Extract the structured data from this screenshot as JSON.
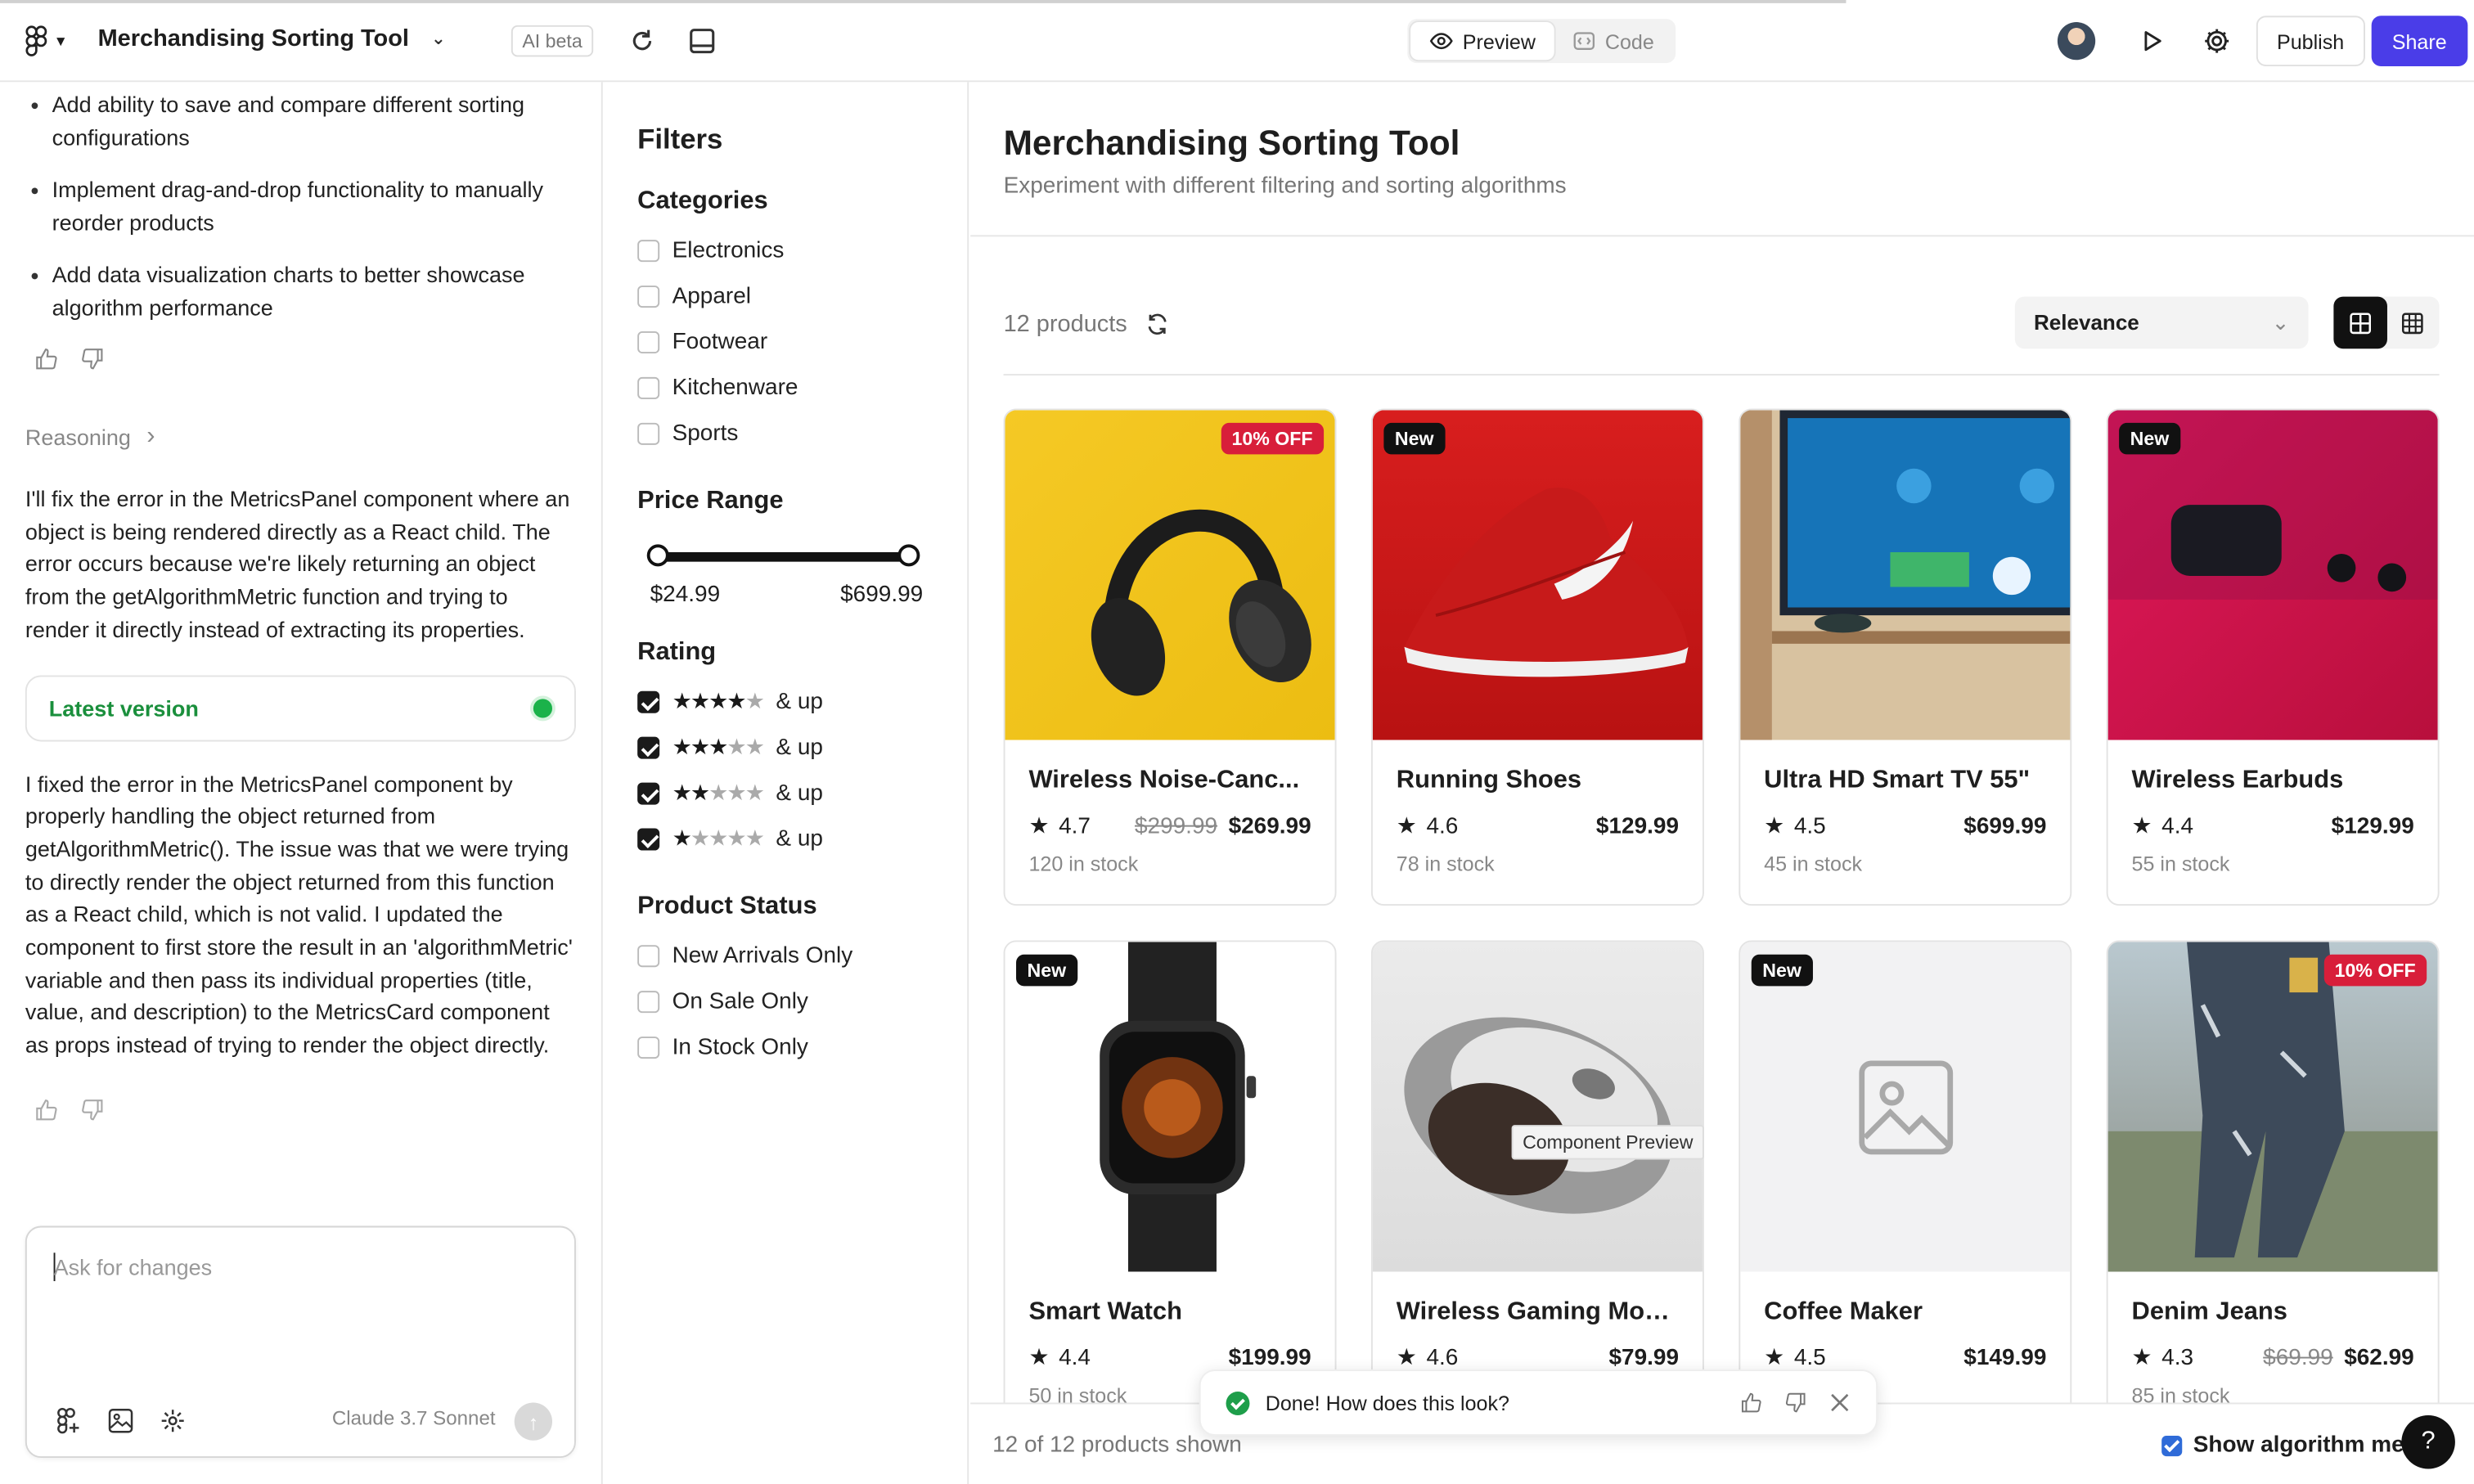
{
  "app": {
    "title": "Merchandising Sorting Tool",
    "ai_badge": "AI beta",
    "tabs": [
      "Preview",
      "Code"
    ],
    "active_tab": "Preview",
    "publish_label": "Publish",
    "share_label": "Share",
    "accent_color": "#4a3de8"
  },
  "chat": {
    "bullets": [
      "Add ability to save and compare different sorting configurations",
      "Implement drag-and-drop functionality to manually reorder products",
      "Add data visualization charts to better showcase algorithm performance"
    ],
    "reasoning_label": "Reasoning",
    "paragraph1": "I'll fix the error in the MetricsPanel component where an object is being rendered directly as a React child. The error occurs because we're likely returning an object from the getAlgorithmMetric function and trying to render it directly instead of extracting its properties.",
    "latest_version_label": "Latest version",
    "paragraph2": "I fixed the error in the MetricsPanel component by properly handling the object returned from getAlgorithmMetric(). The issue was that we were trying to directly render the object returned from this function as a React child, which is not valid. I updated the component to first store the result in an 'algorithmMetric' variable and then pass its individual properties (title, value, and description) to the MetricsCard component as props instead of trying to render the object directly.",
    "input_placeholder": "Ask for changes",
    "model_name": "Claude 3.7 Sonnet"
  },
  "filters": {
    "heading": "Filters",
    "categories_heading": "Categories",
    "categories": [
      "Electronics",
      "Apparel",
      "Footwear",
      "Kitchenware",
      "Sports"
    ],
    "price_heading": "Price Range",
    "price_min": "$24.99",
    "price_max": "$699.99",
    "rating_heading": "Rating",
    "rating_suffix": "& up",
    "ratings": [
      4,
      3,
      2,
      1
    ],
    "status_heading": "Product Status",
    "statuses": [
      "New Arrivals Only",
      "On Sale Only",
      "In Stock Only"
    ]
  },
  "main": {
    "title": "Merchandising Sorting Tool",
    "subtitle": "Experiment with different filtering and sorting algorithms",
    "count": "12 products",
    "sort_value": "Relevance",
    "footer_shown": "12 of 12 products shown",
    "footer_toggle": "Show algorithm me",
    "tooltip": "Component Preview"
  },
  "products": [
    {
      "name": "Wireless Noise-Canc...",
      "rating": "4.7",
      "orig": "$299.99",
      "price": "$269.99",
      "stock": "120 in stock",
      "badge": "10% OFF",
      "image": "headphones"
    },
    {
      "name": "Running Shoes",
      "rating": "4.6",
      "orig": "",
      "price": "$129.99",
      "stock": "78 in stock",
      "badge": "New",
      "image": "shoe"
    },
    {
      "name": "Ultra HD Smart TV 55\"",
      "rating": "4.5",
      "orig": "",
      "price": "$699.99",
      "stock": "45 in stock",
      "badge": "",
      "image": "tv"
    },
    {
      "name": "Wireless Earbuds",
      "rating": "4.4",
      "orig": "",
      "price": "$129.99",
      "stock": "55 in stock",
      "badge": "New",
      "image": "earbuds"
    },
    {
      "name": "Smart Watch",
      "rating": "4.4",
      "orig": "",
      "price": "$199.99",
      "stock": "50 in stock",
      "badge": "New",
      "image": "watch"
    },
    {
      "name": "Wireless Gaming Mou...",
      "rating": "4.6",
      "orig": "",
      "price": "$79.99",
      "stock": "",
      "badge": "",
      "image": "mouse"
    },
    {
      "name": "Coffee Maker",
      "rating": "4.5",
      "orig": "",
      "price": "$149.99",
      "stock": "",
      "badge": "New",
      "image": "placeholder"
    },
    {
      "name": "Denim Jeans",
      "rating": "4.3",
      "orig": "$69.99",
      "price": "$62.99",
      "stock": "85 in stock",
      "badge": "10% OFF",
      "image": "jeans"
    }
  ],
  "toast": {
    "message": "Done! How does this look?"
  },
  "help_label": "?"
}
